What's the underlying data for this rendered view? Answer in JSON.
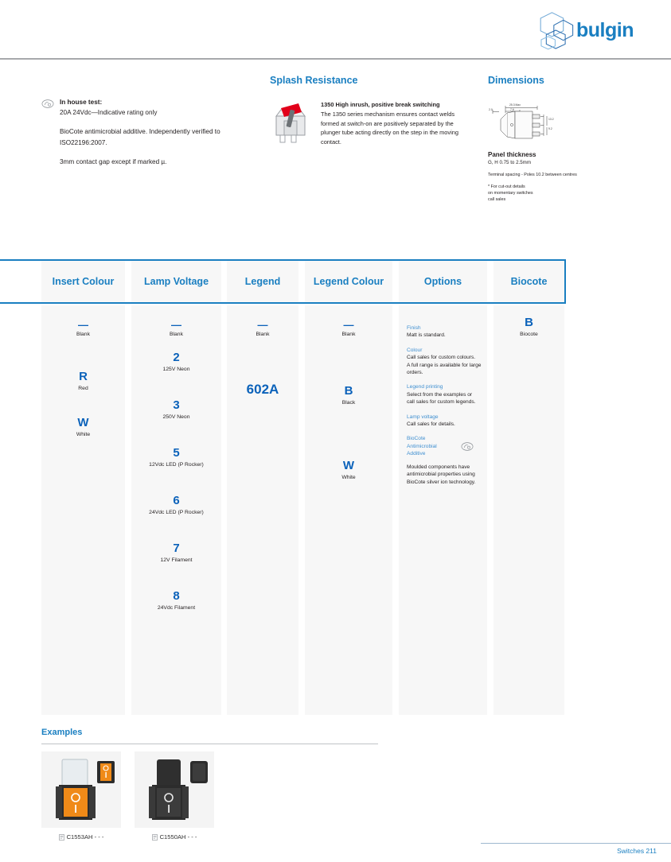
{
  "header": {
    "brand": "bulgin",
    "logo_icon": "hexagon-logo-icon",
    "accent_color": "#1a7fc1"
  },
  "in_house_test": {
    "badge_icon": "biocote-badge-icon",
    "title": "In house test:",
    "rating": "20A 24Vdc—Indicative rating only",
    "paragraph_1": "BioCote antimicrobial additive. Independently verified to ISO22196:2007.",
    "paragraph_2": "3mm contact gap except if marked µ."
  },
  "splash_resistance": {
    "title": "Splash Resistance",
    "image_icon": "rocker-switch-cutaway-icon",
    "heading": "1350 High inrush, positive break switching",
    "body": "The 1350 series mechanism ensures contact welds formed at\nswitch-on are positively separated by the plunger tube acting directly on the step in the moving contact."
  },
  "dimensions": {
    "title": "Dimensions",
    "drawing_icon": "switch-dimension-drawing-icon",
    "drawing_labels": [
      "2.0",
      "25.3 Max",
      "7.6",
      "13.2",
      "9.2"
    ],
    "panel_thickness_title": "Panel thickness",
    "panel_thickness_value": "G, H      0.75 to 2.5mm",
    "terminal_spacing": "Terminal spacing - Poles 10.2 between centres",
    "footnote": "* For cut-out details\non momentary switches\ncall sales"
  },
  "selector_table": {
    "columns": [
      {
        "header": "Insert Colour",
        "entries": [
          {
            "code": "—",
            "label": "Blank"
          },
          {
            "code": "R",
            "label": "Red"
          },
          {
            "code": "W",
            "label": "White"
          }
        ]
      },
      {
        "header": "Lamp Voltage",
        "entries": [
          {
            "code": "—",
            "label": "Blank"
          },
          {
            "code": "2",
            "label": "125V Neon"
          },
          {
            "code": "3",
            "label": "250V Neon"
          },
          {
            "code": "5",
            "label": "12Vdc LED (P Rocker)"
          },
          {
            "code": "6",
            "label": "24Vdc LED (P Rocker)"
          },
          {
            "code": "7",
            "label": "12V Filament"
          },
          {
            "code": "8",
            "label": "24Vdc Filament"
          }
        ]
      },
      {
        "header": "Legend",
        "entries": [
          {
            "code": "—",
            "label": "Blank"
          },
          {
            "code": "602A",
            "label": ""
          }
        ]
      },
      {
        "header": "Legend Colour",
        "entries": [
          {
            "code": "—",
            "label": "Blank"
          },
          {
            "code": "B",
            "label": "Black"
          },
          {
            "code": "W",
            "label": "White"
          }
        ]
      },
      {
        "header": "Options",
        "option_groups": [
          {
            "heading": "Finish",
            "body": "Matt is standard."
          },
          {
            "heading": "Colour",
            "body": "Call sales for custom colours.\nA full range is available for large orders."
          },
          {
            "heading": "Legend printing",
            "body": "Select from the examples or\ncall sales for custom legends."
          },
          {
            "heading": "Lamp voltage",
            "body": "Call sales for details."
          },
          {
            "heading": "BioCote Antimicrobial Additive",
            "badge_icon": "biocote-badge-icon",
            "body": "Moulded components have antimicrobial properties using BioCote silver ion technology."
          }
        ]
      },
      {
        "header": "Biocote",
        "entries": [
          {
            "code": "B",
            "label": "Biocote"
          }
        ]
      }
    ]
  },
  "examples": {
    "title": "Examples",
    "items": [
      {
        "part": "C1553AH - - -",
        "icon": "datasheet-icon",
        "thumb_icon": "orange-rocker-switch-photo"
      },
      {
        "part": "C1550AH - - -",
        "icon": "datasheet-icon",
        "thumb_icon": "black-rocker-switch-photo"
      }
    ]
  },
  "footer": {
    "text": "Switches  211"
  }
}
